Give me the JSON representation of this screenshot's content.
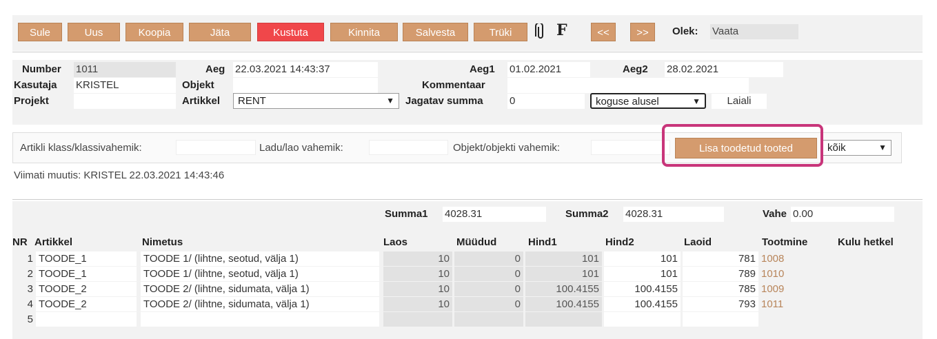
{
  "toolbar": {
    "buttons": [
      "Sule",
      "Uus",
      "Koopia",
      "Jäta",
      "Kustuta",
      "Kinnita",
      "Salvesta",
      "Trüki"
    ],
    "prev": "<<",
    "next": ">>",
    "status_label": "Olek:",
    "status_value": "Vaata",
    "f_label": "F"
  },
  "header": {
    "number_label": "Number",
    "number_value": "1011",
    "aeg_label": "Aeg",
    "aeg_value": "22.03.2021 14:43:37",
    "aeg1_label": "Aeg1",
    "aeg1_value": "01.02.2021",
    "aeg2_label": "Aeg2",
    "aeg2_value": "28.02.2021",
    "kasutaja_label": "Kasutaja",
    "kasutaja_value": "KRISTEL",
    "objekt_label": "Objekt",
    "objekt_value": "",
    "kommentaar_label": "Kommentaar",
    "kommentaar_value": "",
    "projekt_label": "Projekt",
    "projekt_value": "",
    "artikkel_label": "Artikkel",
    "artikkel_value": "RENT",
    "jagatav_label": "Jagatav summa",
    "jagatav_value": "0",
    "jaotus_value": "koguse alusel",
    "laiali_label": "Laiali"
  },
  "filters": {
    "klass_label": "Artikli klass/klassivahemik:",
    "ladu_label": "Ladu/lao vahemik:",
    "objekt_label": "Objekt/objekti vahemik:",
    "add_button": "Lisa toodetud tooted",
    "scope_value": "kõik"
  },
  "modified": "Viimati muutis: KRISTEL 22.03.2021 14:43:46",
  "totals": {
    "summa1_label": "Summa1",
    "summa1_value": "4028.31",
    "summa2_label": "Summa2",
    "summa2_value": "4028.31",
    "vahe_label": "Vahe",
    "vahe_value": "0.00"
  },
  "table": {
    "headers": [
      "NR",
      "Artikkel",
      "Nimetus",
      "Laos",
      "Müüdud",
      "Hind1",
      "Hind2",
      "Laoid",
      "Tootmine",
      "Kulu hetkel"
    ],
    "rows": [
      {
        "nr": "1",
        "artikkel": "TOODE_1",
        "nimetus": "TOODE 1/ (lihtne, seotud, välja 1)",
        "laos": "10",
        "muudud": "0",
        "hind1": "101",
        "hind2": "101",
        "laoid": "781",
        "tootmine": "1008"
      },
      {
        "nr": "2",
        "artikkel": "TOODE_1",
        "nimetus": "TOODE 1/ (lihtne, seotud, välja 1)",
        "laos": "10",
        "muudud": "0",
        "hind1": "101",
        "hind2": "101",
        "laoid": "789",
        "tootmine": "1010"
      },
      {
        "nr": "3",
        "artikkel": "TOODE_2",
        "nimetus": "TOODE 2/ (lihtne, sidumata, välja 1)",
        "laos": "10",
        "muudud": "0",
        "hind1": "100.4155",
        "hind2": "100.4155",
        "laoid": "785",
        "tootmine": "1009"
      },
      {
        "nr": "4",
        "artikkel": "TOODE_2",
        "nimetus": "TOODE 2/ (lihtne, sidumata, välja 1)",
        "laos": "10",
        "muudud": "0",
        "hind1": "100.4155",
        "hind2": "100.4155",
        "laoid": "793",
        "tootmine": "1011"
      },
      {
        "nr": "5",
        "artikkel": "",
        "nimetus": "",
        "laos": "",
        "muudud": "",
        "hind1": "",
        "hind2": "",
        "laoid": "",
        "tootmine": ""
      }
    ]
  },
  "colors": {
    "button": "#d49b6e",
    "delete_button": "#f0474a",
    "highlight": "#c8357a",
    "link": "#b8855a"
  },
  "icons": [
    "paperclip-icon"
  ]
}
